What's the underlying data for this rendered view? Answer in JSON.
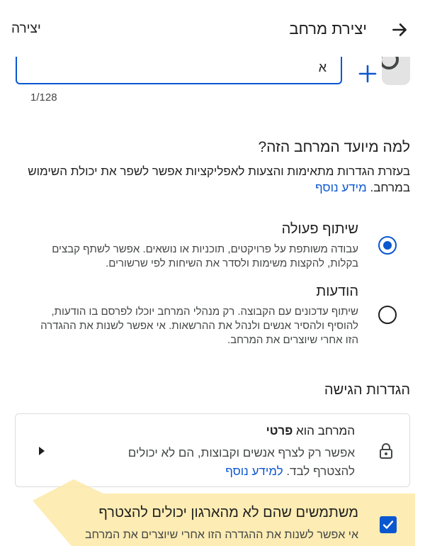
{
  "header": {
    "title": "יצירת מרחב",
    "create_label": "יצירה"
  },
  "name_field": {
    "value": "א",
    "char_count": "1/128"
  },
  "purpose": {
    "title": "למה מיועד המרחב הזה?",
    "description": "בעזרת הגדרות מתאימות והצעות לאפליקציות אפשר לשפר את יכולת השימוש במרחב.",
    "learn_more": "מידע נוסף",
    "options": [
      {
        "title": "שיתוף פעולה",
        "description": "עבודה משותפת על פרויקטים, תוכניות או נושאים. אפשר לשתף קבצים בקלות, להקצות משימות ולסדר את השיחות לפי שרשורים.",
        "selected": true
      },
      {
        "title": "הודעות",
        "description": "שיתוף עדכונים עם הקבוצה. רק מנהלי המרחב יוכלו לפרסם בו הודעות, להוסיף ולהסיר אנשים ולנהל את ההרשאות. אי אפשר לשנות את ההגדרה הזו אחרי שיוצרים את המרחב.",
        "selected": false
      }
    ]
  },
  "access": {
    "title": "הגדרות הגישה",
    "card_title_prefix": "המרחב הוא",
    "card_title_bold": "פרטי",
    "card_description": "אפשר רק לצרף אנשים וקבוצות, הם לא יכולים להצטרף לבד.",
    "card_learn_more": "למידע נוסף"
  },
  "external": {
    "title": "משתמשים שהם לא מהארגון יכולים להצטרף",
    "description": "אי אפשר לשנות את ההגדרה הזו אחרי שיוצרים את המרחב",
    "checked": true
  },
  "colors": {
    "accent": "#0b57d0",
    "highlight": "#fde9a6"
  }
}
